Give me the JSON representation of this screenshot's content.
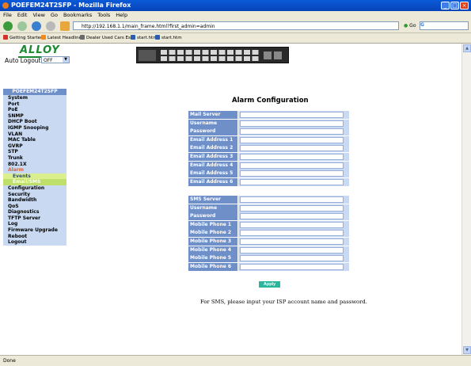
{
  "window": {
    "title": "POEFEM24T2SFP - Mozilla Firefox",
    "controls": [
      "minimize",
      "maximize",
      "close"
    ]
  },
  "menubar": [
    "File",
    "Edit",
    "View",
    "Go",
    "Bookmarks",
    "Tools",
    "Help"
  ],
  "navbar": {
    "url": "http://192.168.1.1/main_frame.html?first_admin=admin",
    "go_label": "Go",
    "search_placeholder": ""
  },
  "bookmarks": [
    {
      "label": "Getting Started",
      "color": "#d6302b"
    },
    {
      "label": "Latest Headlines",
      "color": "#f08a1c"
    },
    {
      "label": "Dealer Used Cars Es...",
      "color": "#6a6a6a"
    },
    {
      "label": "start.htm",
      "color": "#2a5db0"
    },
    {
      "label": "start.htm",
      "color": "#2a5db0"
    }
  ],
  "header": {
    "logo": "ALLOY",
    "auto_logout_label": "Auto Logout",
    "auto_logout_value": "OFF"
  },
  "sidebar": {
    "title": "POEFEM24T2SFP",
    "items": [
      {
        "label": "System"
      },
      {
        "label": "Port"
      },
      {
        "label": "PoE"
      },
      {
        "label": "SNMP"
      },
      {
        "label": "DHCP Boot"
      },
      {
        "label": "IGMP Snooping"
      },
      {
        "label": "VLAN"
      },
      {
        "label": "MAC Table"
      },
      {
        "label": "GVRP"
      },
      {
        "label": "STP"
      },
      {
        "label": "Trunk"
      },
      {
        "label": "802.1X"
      },
      {
        "label": "Alarm",
        "selected": true
      }
    ],
    "subitems": [
      {
        "label": "Events",
        "active": false
      },
      {
        "label": "Email/SMS",
        "active": true
      }
    ],
    "items_after": [
      {
        "label": "Configuration"
      },
      {
        "label": "Security"
      },
      {
        "label": "Bandwidth"
      },
      {
        "label": "QoS"
      },
      {
        "label": "Diagnostics"
      },
      {
        "label": "TFTP Server"
      },
      {
        "label": "Log"
      },
      {
        "label": "Firmware Upgrade"
      },
      {
        "label": "Reboot"
      },
      {
        "label": "Logout"
      }
    ]
  },
  "main": {
    "title": "Alarm Configuration",
    "email_fields": [
      {
        "label": "Mail Server",
        "value": ""
      },
      {
        "label": "Username",
        "value": ""
      },
      {
        "label": "Password",
        "value": ""
      },
      {
        "label": "Email Address 1",
        "value": ""
      },
      {
        "label": "Email Address 2",
        "value": ""
      },
      {
        "label": "Email Address 3",
        "value": ""
      },
      {
        "label": "Email Address 4",
        "value": ""
      },
      {
        "label": "Email Address 5",
        "value": ""
      },
      {
        "label": "Email Address 6",
        "value": ""
      }
    ],
    "sms_fields": [
      {
        "label": "SMS Server",
        "value": ""
      },
      {
        "label": "Username",
        "value": ""
      },
      {
        "label": "Password",
        "value": ""
      },
      {
        "label": "Mobile Phone 1",
        "value": ""
      },
      {
        "label": "Mobile Phone 2",
        "value": ""
      },
      {
        "label": "Mobile Phone 3",
        "value": ""
      },
      {
        "label": "Mobile Phone 4",
        "value": ""
      },
      {
        "label": "Mobile Phone 5",
        "value": ""
      },
      {
        "label": "Mobile Phone 6",
        "value": ""
      }
    ],
    "apply_label": "Apply",
    "note": "For SMS, please input your ISP account name and password."
  },
  "status": "Done",
  "colors": {
    "label_bg": "#6f8fc9",
    "row_bg": "#c8d9f1",
    "submenu_bg": "#dbf08c",
    "apply_bg": "#2bb59c",
    "logo_green": "#1b8a2f"
  }
}
